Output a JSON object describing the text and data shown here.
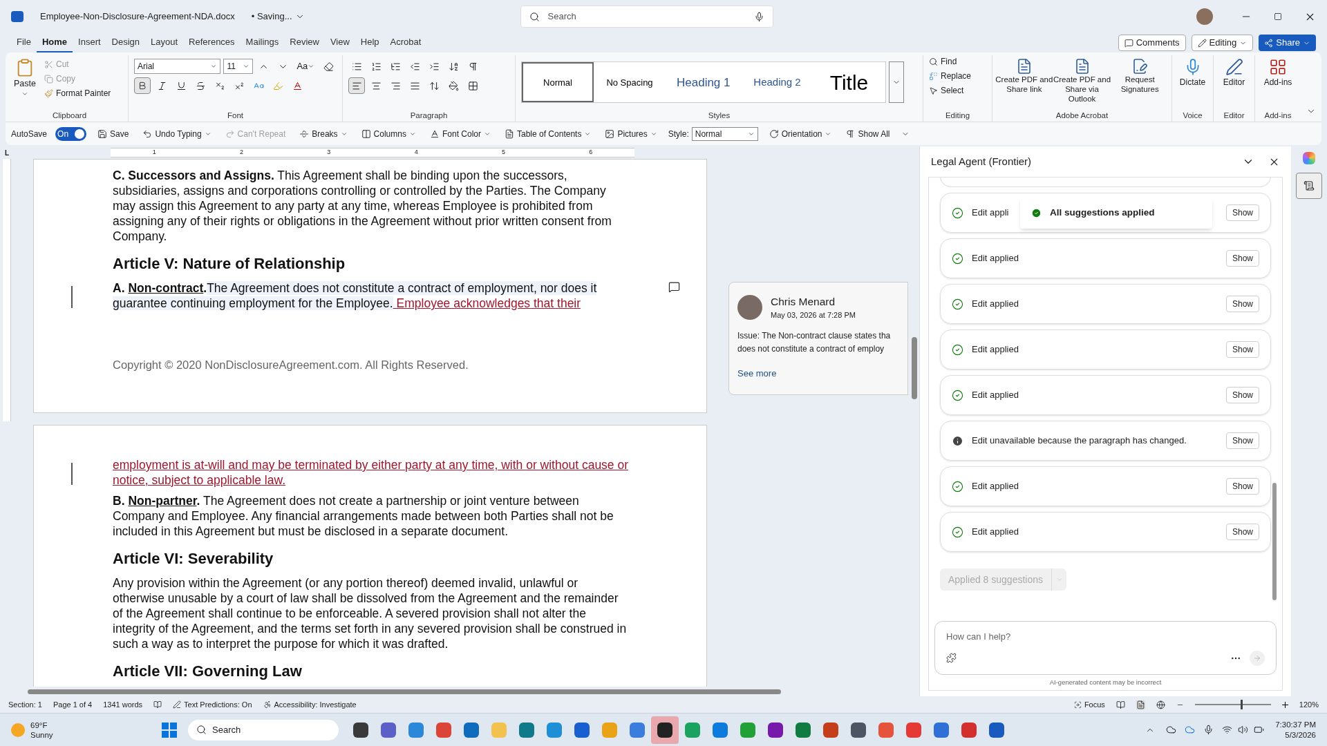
{
  "title_bar": {
    "filename": "Employee-Non-Disclosure-Agreement-NDA.docx",
    "status": "• Saving...",
    "search_placeholder": "Search"
  },
  "menu_tabs": [
    {
      "label": "File",
      "selected": false
    },
    {
      "label": "Home",
      "selected": true
    },
    {
      "label": "Insert",
      "selected": false
    },
    {
      "label": "Design",
      "selected": false
    },
    {
      "label": "Layout",
      "selected": false
    },
    {
      "label": "References",
      "selected": false
    },
    {
      "label": "Mailings",
      "selected": false
    },
    {
      "label": "Review",
      "selected": false
    },
    {
      "label": "View",
      "selected": false
    },
    {
      "label": "Help",
      "selected": false
    },
    {
      "label": "Acrobat",
      "selected": false
    }
  ],
  "header_buttons": {
    "comments": "Comments",
    "editing": "Editing",
    "share": "Share"
  },
  "ribbon": {
    "clipboard": {
      "label": "Clipboard",
      "paste": "Paste",
      "cut": "Cut",
      "copy": "Copy",
      "format_painter": "Format Painter"
    },
    "font": {
      "label": "Font",
      "font_name": "Arial",
      "font_size": "11",
      "change_case": "Aa"
    },
    "paragraph": {
      "label": "Paragraph"
    },
    "styles": {
      "label": "Styles",
      "items": [
        {
          "label": "Normal",
          "kind": "normal",
          "selected": true
        },
        {
          "label": "No Spacing",
          "kind": "normal",
          "selected": false
        },
        {
          "label": "Heading 1",
          "kind": "heading1",
          "selected": false
        },
        {
          "label": "Heading 2",
          "kind": "heading2",
          "selected": false
        },
        {
          "label": "Title",
          "kind": "title",
          "selected": false
        }
      ]
    },
    "editing": {
      "label": "Editing",
      "find": "Find",
      "replace": "Replace",
      "select": "Select"
    },
    "acrobat": {
      "label": "Adobe Acrobat",
      "items": [
        "Create PDF and Share link",
        "Create PDF and Share via Outlook",
        "Request Signatures"
      ]
    },
    "voice": {
      "label": "Voice",
      "dictate": "Dictate"
    },
    "editor": {
      "label": "Editor",
      "button": "Editor"
    },
    "addins": {
      "label": "Add-ins",
      "button": "Add-ins"
    }
  },
  "quick_toolbar": {
    "autosave": {
      "label": "AutoSave",
      "on": true,
      "state_text": "On"
    },
    "items": [
      {
        "label": "Save",
        "kind": "save",
        "disabled": false
      },
      {
        "label": "Undo Typing",
        "kind": "undo",
        "disabled": false
      },
      {
        "label": "Can't Repeat",
        "kind": "redo",
        "disabled": true
      },
      {
        "label": "Breaks",
        "kind": "breaks",
        "disabled": false
      },
      {
        "label": "Columns",
        "kind": "columns",
        "disabled": false
      },
      {
        "label": "Font Color",
        "kind": "fontcolor",
        "disabled": false
      },
      {
        "label": "Table of Contents",
        "kind": "toc",
        "disabled": false
      },
      {
        "label": "Pictures",
        "kind": "pictures",
        "disabled": false
      }
    ],
    "style_label": "Style:",
    "style_value": "Normal",
    "items_after": [
      {
        "label": "Orientation",
        "kind": "orientation",
        "disabled": false
      },
      {
        "label": "Show All",
        "kind": "showall",
        "disabled": false
      }
    ]
  },
  "ruler": {
    "corner": "L",
    "numbers": [
      "1",
      "2",
      "3",
      "4",
      "5",
      "6"
    ]
  },
  "pages": [
    {
      "blocks": [
        {
          "kind": "paragraph",
          "segments": [
            {
              "text": "C. Successors and Assigns.",
              "kind": "bold"
            },
            {
              "text": " This Agreement shall be binding upon the successors, subsidiaries, assigns and corporations controlling or controlled by the Parties. The Company may assign this Agreement to any party at any time, whereas Employee is prohibited from assigning any of their rights or obligations in the Agreement without prior written consent from Company.",
              "kind": "plain"
            }
          ]
        },
        {
          "kind": "heading",
          "segments": [
            {
              "text": "Article V: Nature of Relationship",
              "kind": "plain"
            }
          ]
        },
        {
          "kind": "changed",
          "segments": [
            {
              "text": "A. ",
              "kind": "bold"
            },
            {
              "text": "Non-contract",
              "kind": "term"
            },
            {
              "text": ".",
              "kind": "bold"
            },
            {
              "text": "The Agreement does not constitute a contract of employment, nor does it guarantee continuing employment for the Employee.",
              "kind": "highlight"
            },
            {
              "text": " Employee acknowledges that their",
              "kind": "inserted"
            }
          ]
        },
        {
          "kind": "footer",
          "segments": [
            {
              "text": "Copyright © 2020 NonDisclosureAgreement.com. All Rights Reserved.",
              "kind": "plain"
            }
          ]
        }
      ]
    },
    {
      "blocks": [
        {
          "kind": "changed",
          "segments": [
            {
              "text": "employment is at-will and may be terminated by either party at any time, with or without cause or notice, subject to applicable law.",
              "kind": "inserted"
            }
          ]
        },
        {
          "kind": "paragraph",
          "segments": [
            {
              "text": "B. ",
              "kind": "bold"
            },
            {
              "text": "Non-partner",
              "kind": "term"
            },
            {
              "text": ".",
              "kind": "bold"
            },
            {
              "text": " The Agreement does not create a partnership or joint venture between Company and Employee. Any financial arrangements made between both Parties shall not be included in this Agreement but must be disclosed in a separate document.",
              "kind": "plain"
            }
          ]
        },
        {
          "kind": "heading",
          "segments": [
            {
              "text": "Article VI: Severability",
              "kind": "plain"
            }
          ]
        },
        {
          "kind": "paragraph",
          "segments": [
            {
              "text": "Any provision within the Agreement (or any portion thereof) deemed invalid, unlawful or otherwise unusable by a court of law shall be dissolved from the Agreement and the remainder of the Agreement shall continue to be enforceable. A severed provision shall not alter the integrity of the Agreement, and the terms set forth in any severed provision shall be construed in such a way as to interpret the purpose for which it was drafted.",
              "kind": "plain"
            }
          ]
        },
        {
          "kind": "heading",
          "segments": [
            {
              "text": "Article VII: Governing Law",
              "kind": "plain"
            }
          ]
        }
      ]
    }
  ],
  "comment": {
    "author": "Chris Menard",
    "date": "May 03, 2026 at 7:28 PM",
    "lines": [
      "Issue: The Non-contract clause states tha",
      "does not constitute a contract of employ"
    ],
    "see_more": "See more"
  },
  "agent_panel": {
    "title": "Legal Agent (Frontier)",
    "toast": "All suggestions applied",
    "items": [
      {
        "kind": "applied",
        "text": "Edit appli",
        "button": "Show"
      },
      {
        "kind": "applied",
        "text": "Edit applied",
        "button": "Show"
      },
      {
        "kind": "applied",
        "text": "Edit applied",
        "button": "Show"
      },
      {
        "kind": "applied",
        "text": "Edit applied",
        "button": "Show"
      },
      {
        "kind": "applied",
        "text": "Edit applied",
        "button": "Show"
      },
      {
        "kind": "unavailable",
        "text": "Edit unavailable because the paragraph has changed.",
        "button": "Show"
      },
      {
        "kind": "applied",
        "text": "Edit applied",
        "button": "Show"
      },
      {
        "kind": "applied",
        "text": "Edit applied",
        "button": "Show"
      }
    ],
    "apply_button": {
      "label": "Applied 8 suggestions",
      "disabled": true
    },
    "input_placeholder": "How can I help?",
    "disclaimer": "AI-generated content may be incorrect"
  },
  "status_bar": {
    "section": "Section: 1",
    "page": "Page 1 of 4",
    "words": "1341 words",
    "predictions": "Text Predictions: On",
    "accessibility": "Accessibility: Investigate",
    "focus": "Focus",
    "zoom": "120%",
    "zoom_slider": {
      "level": 0.6
    }
  },
  "taskbar": {
    "temperature": "69°F",
    "weather": "Sunny",
    "search": "Search",
    "time": "7:30:37 PM",
    "date": "5/3/2026",
    "apps": [
      {
        "color": "#3a3a3a",
        "selected": false
      },
      {
        "color": "#5b5fc7",
        "selected": false
      },
      {
        "color": "#2b88d8",
        "selected": false
      },
      {
        "color": "#db4437",
        "selected": false
      },
      {
        "color": "#0f6cbd",
        "selected": false
      },
      {
        "color": "#f2c14e",
        "selected": false
      },
      {
        "color": "#0f7b8a",
        "selected": false
      },
      {
        "color": "#1e8fd6",
        "selected": false
      },
      {
        "color": "#1a5fd0",
        "selected": false
      },
      {
        "color": "#e8a317",
        "selected": false
      },
      {
        "color": "#3b7ddd",
        "selected": false
      },
      {
        "color": "#222222",
        "selected": true
      },
      {
        "color": "#1aa260",
        "selected": false
      },
      {
        "color": "#0c7bdc",
        "selected": false
      },
      {
        "color": "#21a038",
        "selected": false
      },
      {
        "color": "#7719aa",
        "selected": false
      },
      {
        "color": "#107c41",
        "selected": false
      },
      {
        "color": "#c43e1c",
        "selected": false
      },
      {
        "color": "#4b5563",
        "selected": false
      },
      {
        "color": "#e5533d",
        "selected": false
      },
      {
        "color": "#e53935",
        "selected": false
      },
      {
        "color": "#2f6fd6",
        "selected": false
      },
      {
        "color": "#d32f2f",
        "selected": false
      },
      {
        "color": "#185abd",
        "selected": false
      }
    ]
  }
}
